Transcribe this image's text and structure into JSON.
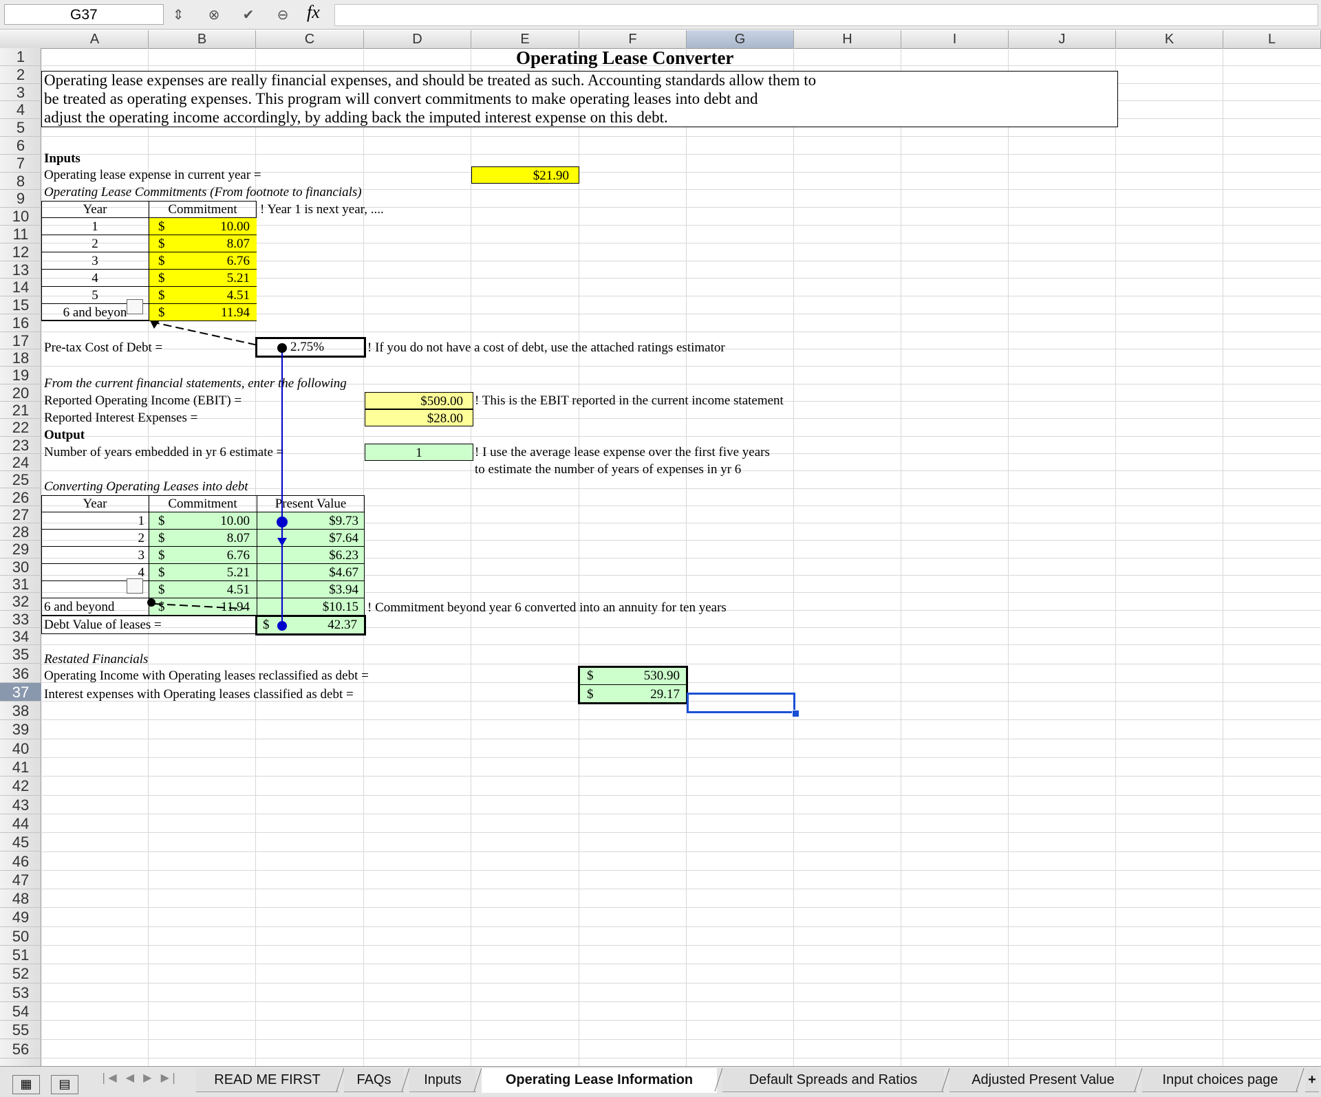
{
  "formula_bar": {
    "cell_ref": "G37",
    "fx": "fx",
    "formula": ""
  },
  "columns": [
    "A",
    "B",
    "C",
    "D",
    "E",
    "F",
    "G",
    "H",
    "I",
    "J",
    "K",
    "L"
  ],
  "rows": [
    "1",
    "2",
    "3",
    "4",
    "5",
    "6",
    "7",
    "8",
    "9",
    "10",
    "11",
    "12",
    "13",
    "14",
    "15",
    "16",
    "17",
    "18",
    "19",
    "20",
    "21",
    "22",
    "23",
    "24",
    "25",
    "26",
    "27",
    "28",
    "29",
    "30",
    "31",
    "32",
    "33",
    "34",
    "35",
    "36",
    "37",
    "38",
    "39",
    "40",
    "41",
    "42",
    "43",
    "44",
    "45",
    "46",
    "47",
    "48",
    "49",
    "50",
    "51",
    "52",
    "53",
    "54",
    "55",
    "56"
  ],
  "selected": {
    "column": "G",
    "row": "37"
  },
  "sheet": {
    "title": "Operating Lease Converter",
    "description": [
      "Operating lease expenses are really financial expenses, and should be treated as such. Accounting standards allow them to",
      "be treated as operating expenses. This program will convert commitments to make operating leases into debt and",
      "adjust the operating income accordingly, by adding back the imputed interest expense on this debt."
    ],
    "inputs_label": "Inputs",
    "lease_expense_label": "Operating lease expense in current year =",
    "lease_expense_value": "$21.90",
    "commitments_label": "Operating Lease Commitments (From footnote to financials)",
    "year_header": "Year",
    "commitment_header": "Commitment",
    "year_note": "! Year 1 is next year, ....",
    "commitments": [
      {
        "year": "1",
        "cur": "$",
        "value": "10.00"
      },
      {
        "year": "2",
        "cur": "$",
        "value": "8.07"
      },
      {
        "year": "3",
        "cur": "$",
        "value": "6.76"
      },
      {
        "year": "4",
        "cur": "$",
        "value": "5.21"
      },
      {
        "year": "5",
        "cur": "$",
        "value": "4.51"
      },
      {
        "year": "6 and beyon",
        "cur": "$",
        "value": "11.94"
      }
    ],
    "cost_of_debt_label": "Pre-tax Cost of Debt =",
    "cost_of_debt_value": "2.75%",
    "cost_of_debt_note": "! If you do not have a cost of debt, use the attached ratings estimator",
    "from_statements_label": "From the current financial statements, enter the following",
    "ebit_label": "Reported Operating Income (EBIT) =",
    "ebit_value": "$509.00",
    "ebit_note": "! This is the EBIT reported in the current income statement",
    "interest_label": "Reported Interest Expenses =",
    "interest_value": "$28.00",
    "output_label": "Output",
    "years_embedded_label": "Number of years embedded in yr 6 estimate =",
    "years_embedded_value": "1",
    "years_note_1": "! I use the average lease expense over the first five years",
    "years_note_2": "to estimate the number of years of expenses in yr 6",
    "converting_label": "Converting Operating Leases into debt",
    "pv_header": "Present Value",
    "conversion": [
      {
        "year": "1",
        "cur": "$",
        "value": "10.00",
        "pv": "$9.73"
      },
      {
        "year": "2",
        "cur": "$",
        "value": "8.07",
        "pv": "$7.64"
      },
      {
        "year": "3",
        "cur": "$",
        "value": "6.76",
        "pv": "$6.23"
      },
      {
        "year": "4",
        "cur": "$",
        "value": "5.21",
        "pv": "$4.67"
      },
      {
        "year": "",
        "cur": "$",
        "value": "4.51",
        "pv": "$3.94"
      },
      {
        "year": "6 and beyond",
        "cur": "$",
        "value": "11.94",
        "pv": "$10.15"
      }
    ],
    "conversion_note": "! Commitment beyond year 6 converted into an annuity for ten years",
    "debt_value_label": "Debt Value of leases =",
    "debt_value_cur": "$",
    "debt_value": "42.37",
    "restated_label": "Restated Financials",
    "op_income_restated_label": "Operating Income with Operating leases reclassified as debt =",
    "op_income_restated_cur": "$",
    "op_income_restated_value": "530.90",
    "interest_restated_label": "Interest expenses with Operating leases classified as debt =",
    "interest_restated_cur": "$",
    "interest_restated_value": "29.17"
  },
  "tabs": [
    {
      "label": "READ ME FIRST"
    },
    {
      "label": "FAQs"
    },
    {
      "label": "Inputs"
    },
    {
      "label": "Operating Lease Information"
    },
    {
      "label": "Default Spreads and Ratios"
    },
    {
      "label": "Adjusted Present Value"
    },
    {
      "label": "Input choices page"
    }
  ],
  "active_tab": "Operating Lease Information",
  "add_sheet": "+",
  "colors": {
    "input_yellow": "#ffff00",
    "light_yellow": "#ffff99",
    "output_green": "#ccffcc",
    "selection": "#1a4fd6",
    "trace_arrow": "#0000cc"
  }
}
